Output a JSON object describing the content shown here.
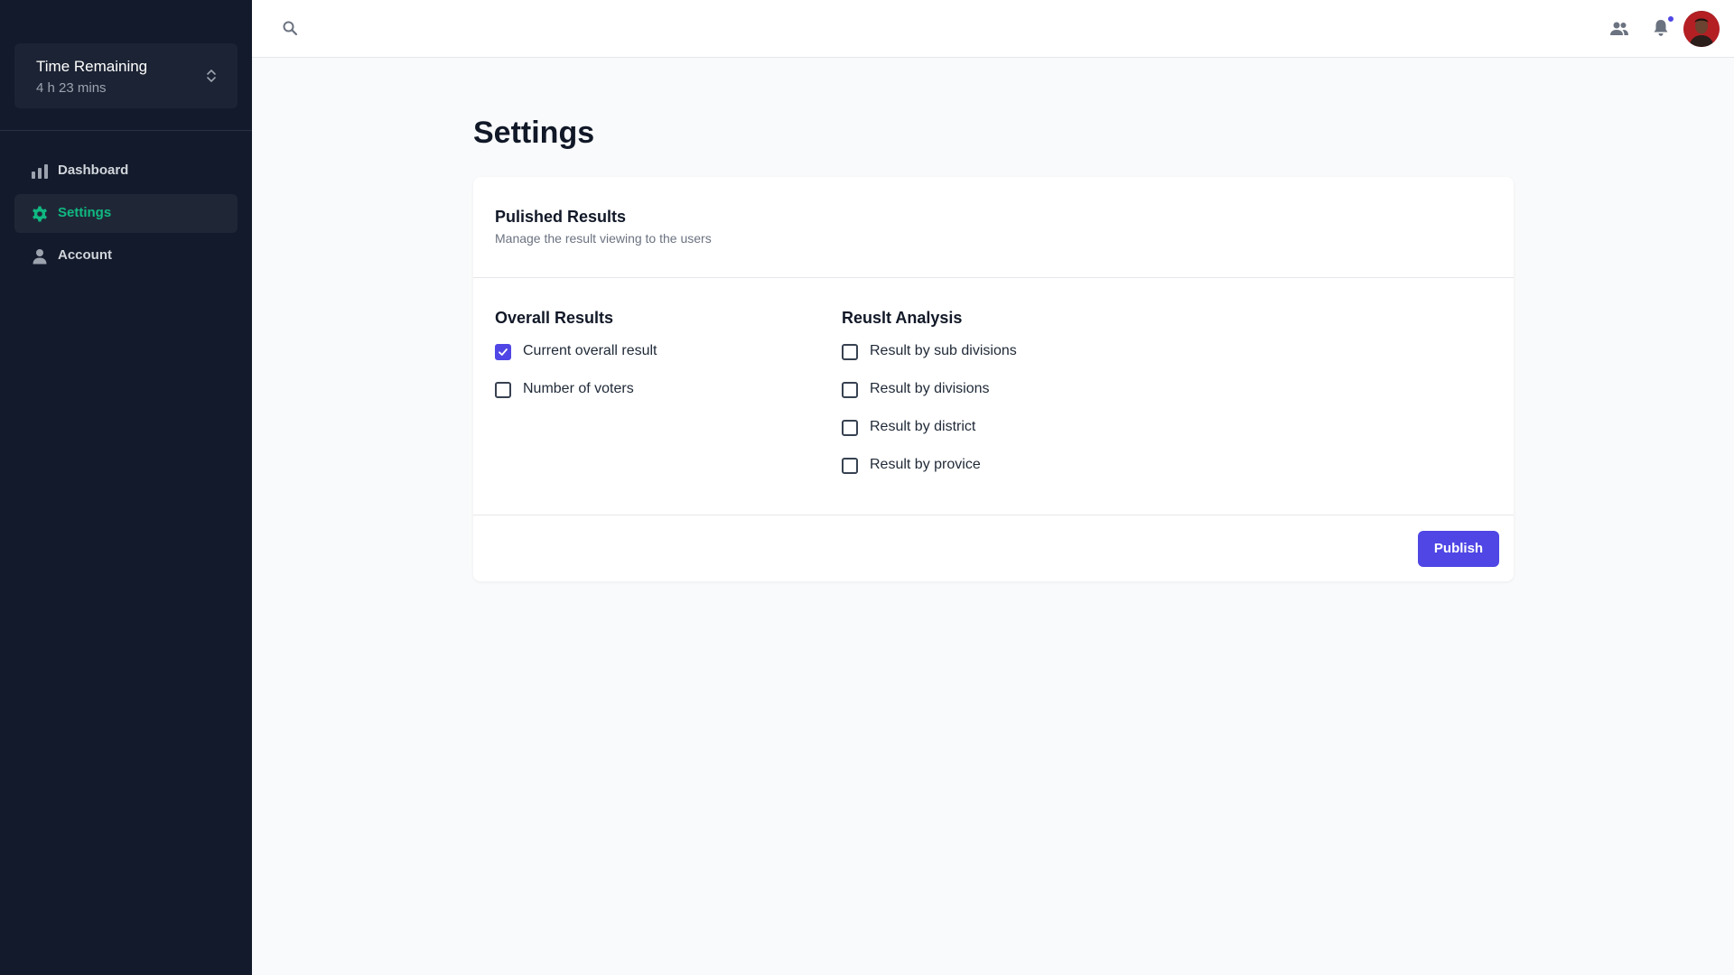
{
  "sidebar": {
    "timer": {
      "title": "Time Remaining",
      "value": "4 h 23 mins"
    },
    "items": [
      {
        "label": "Dashboard",
        "icon": "bar-chart-icon",
        "active": false
      },
      {
        "label": "Settings",
        "icon": "gear-icon",
        "active": true
      },
      {
        "label": "Account",
        "icon": "user-icon",
        "active": false
      }
    ]
  },
  "topbar": {
    "icons": [
      "search-icon",
      "people-icon",
      "bell-icon",
      "avatar"
    ],
    "notification_dot_color": "#4f46e5"
  },
  "page": {
    "title": "Settings"
  },
  "card": {
    "title": "Pulished Results",
    "subtitle": "Manage the result viewing to the users",
    "overall": {
      "heading": "Overall Results",
      "options": [
        {
          "label": "Current overall result",
          "checked": true
        },
        {
          "label": "Number of voters",
          "checked": false
        }
      ]
    },
    "analysis": {
      "heading": "Reuslt Analysis",
      "options": [
        {
          "label": "Result by sub divisions",
          "checked": false
        },
        {
          "label": "Result by divisions",
          "checked": false
        },
        {
          "label": "Result by district",
          "checked": false
        },
        {
          "label": "Result by provice",
          "checked": false
        }
      ]
    },
    "publish_label": "Publish"
  },
  "colors": {
    "sidebar_bg": "#131a2b",
    "accent": "#4f46e5",
    "active_nav": "#10b981"
  }
}
